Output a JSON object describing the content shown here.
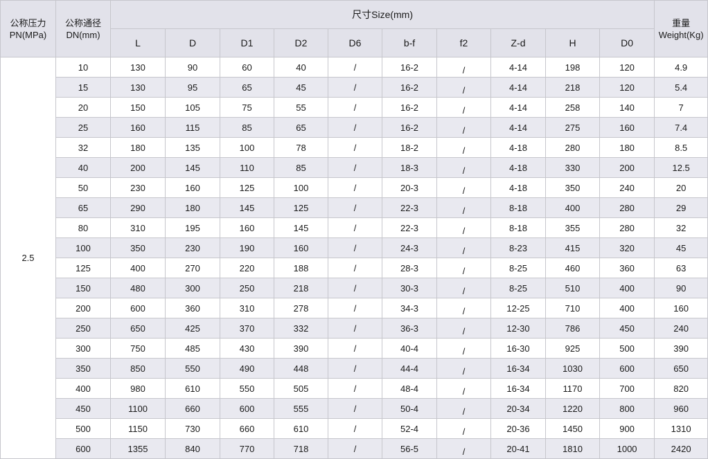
{
  "header": {
    "pn_cn": "公称压力",
    "pn_en": "PN(MPa)",
    "dn_cn": "公称通径",
    "dn_en": "DN(mm)",
    "size_title": "尺寸Size(mm)",
    "weight_cn": "重量",
    "weight_en": "Weight(Kg)",
    "columns": [
      "L",
      "D",
      "D1",
      "D2",
      "D6",
      "b-f",
      "f2",
      "Z-d",
      "H",
      "D0"
    ]
  },
  "pn_value": "2.5",
  "rows": [
    {
      "dn": "10",
      "L": "130",
      "D": "90",
      "D1": "60",
      "D2": "40",
      "D6": "/",
      "bf": "16-2",
      "f2": "/",
      "zd": "4-14",
      "H": "198",
      "D0": "120",
      "weight": "4.9"
    },
    {
      "dn": "15",
      "L": "130",
      "D": "95",
      "D1": "65",
      "D2": "45",
      "D6": "/",
      "bf": "16-2",
      "f2": "/",
      "zd": "4-14",
      "H": "218",
      "D0": "120",
      "weight": "5.4"
    },
    {
      "dn": "20",
      "L": "150",
      "D": "105",
      "D1": "75",
      "D2": "55",
      "D6": "/",
      "bf": "16-2",
      "f2": "/",
      "zd": "4-14",
      "H": "258",
      "D0": "140",
      "weight": "7"
    },
    {
      "dn": "25",
      "L": "160",
      "D": "115",
      "D1": "85",
      "D2": "65",
      "D6": "/",
      "bf": "16-2",
      "f2": "/",
      "zd": "4-14",
      "H": "275",
      "D0": "160",
      "weight": "7.4"
    },
    {
      "dn": "32",
      "L": "180",
      "D": "135",
      "D1": "100",
      "D2": "78",
      "D6": "/",
      "bf": "18-2",
      "f2": "/",
      "zd": "4-18",
      "H": "280",
      "D0": "180",
      "weight": "8.5"
    },
    {
      "dn": "40",
      "L": "200",
      "D": "145",
      "D1": "110",
      "D2": "85",
      "D6": "/",
      "bf": "18-3",
      "f2": "/",
      "zd": "4-18",
      "H": "330",
      "D0": "200",
      "weight": "12.5"
    },
    {
      "dn": "50",
      "L": "230",
      "D": "160",
      "D1": "125",
      "D2": "100",
      "D6": "/",
      "bf": "20-3",
      "f2": "/",
      "zd": "4-18",
      "H": "350",
      "D0": "240",
      "weight": "20"
    },
    {
      "dn": "65",
      "L": "290",
      "D": "180",
      "D1": "145",
      "D2": "125",
      "D6": "/",
      "bf": "22-3",
      "f2": "/",
      "zd": "8-18",
      "H": "400",
      "D0": "280",
      "weight": "29"
    },
    {
      "dn": "80",
      "L": "310",
      "D": "195",
      "D1": "160",
      "D2": "145",
      "D6": "/",
      "bf": "22-3",
      "f2": "/",
      "zd": "8-18",
      "H": "355",
      "D0": "280",
      "weight": "32"
    },
    {
      "dn": "100",
      "L": "350",
      "D": "230",
      "D1": "190",
      "D2": "160",
      "D6": "/",
      "bf": "24-3",
      "f2": "/",
      "zd": "8-23",
      "H": "415",
      "D0": "320",
      "weight": "45"
    },
    {
      "dn": "125",
      "L": "400",
      "D": "270",
      "D1": "220",
      "D2": "188",
      "D6": "/",
      "bf": "28-3",
      "f2": "/",
      "zd": "8-25",
      "H": "460",
      "D0": "360",
      "weight": "63"
    },
    {
      "dn": "150",
      "L": "480",
      "D": "300",
      "D1": "250",
      "D2": "218",
      "D6": "/",
      "bf": "30-3",
      "f2": "/",
      "zd": "8-25",
      "H": "510",
      "D0": "400",
      "weight": "90"
    },
    {
      "dn": "200",
      "L": "600",
      "D": "360",
      "D1": "310",
      "D2": "278",
      "D6": "/",
      "bf": "34-3",
      "f2": "/",
      "zd": "12-25",
      "H": "710",
      "D0": "400",
      "weight": "160"
    },
    {
      "dn": "250",
      "L": "650",
      "D": "425",
      "D1": "370",
      "D2": "332",
      "D6": "/",
      "bf": "36-3",
      "f2": "/",
      "zd": "12-30",
      "H": "786",
      "D0": "450",
      "weight": "240"
    },
    {
      "dn": "300",
      "L": "750",
      "D": "485",
      "D1": "430",
      "D2": "390",
      "D6": "/",
      "bf": "40-4",
      "f2": "/",
      "zd": "16-30",
      "H": "925",
      "D0": "500",
      "weight": "390"
    },
    {
      "dn": "350",
      "L": "850",
      "D": "550",
      "D1": "490",
      "D2": "448",
      "D6": "/",
      "bf": "44-4",
      "f2": "/",
      "zd": "16-34",
      "H": "1030",
      "D0": "600",
      "weight": "650"
    },
    {
      "dn": "400",
      "L": "980",
      "D": "610",
      "D1": "550",
      "D2": "505",
      "D6": "/",
      "bf": "48-4",
      "f2": "/",
      "zd": "16-34",
      "H": "1170",
      "D0": "700",
      "weight": "820"
    },
    {
      "dn": "450",
      "L": "1100",
      "D": "660",
      "D1": "600",
      "D2": "555",
      "D6": "/",
      "bf": "50-4",
      "f2": "/",
      "zd": "20-34",
      "H": "1220",
      "D0": "800",
      "weight": "960"
    },
    {
      "dn": "500",
      "L": "1150",
      "D": "730",
      "D1": "660",
      "D2": "610",
      "D6": "/",
      "bf": "52-4",
      "f2": "/",
      "zd": "20-36",
      "H": "1450",
      "D0": "900",
      "weight": "1310"
    },
    {
      "dn": "600",
      "L": "1355",
      "D": "840",
      "D1": "770",
      "D2": "718",
      "D6": "/",
      "bf": "56-5",
      "f2": "/",
      "zd": "20-41",
      "H": "1810",
      "D0": "1000",
      "weight": "2420"
    }
  ]
}
